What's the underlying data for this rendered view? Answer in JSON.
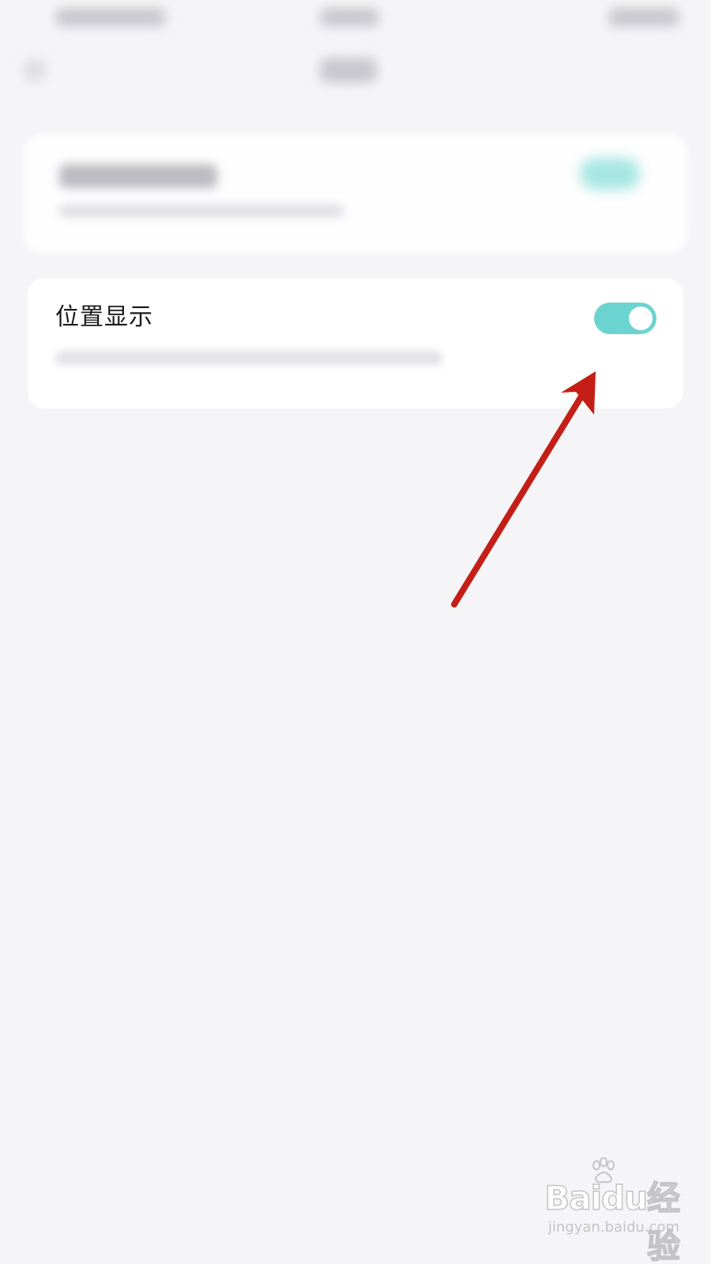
{
  "setting": {
    "label": "位置显示",
    "toggle_state": "on"
  },
  "colors": {
    "background": "#f5f5f8",
    "card": "#ffffff",
    "toggle_on": "#6bd4d1",
    "annotation_arrow": "#c41f16"
  },
  "icons": {
    "toggle": "toggle-switch-icon",
    "annotation": "red-arrow-icon"
  },
  "watermark": {
    "logo": "Baidu经验",
    "url": "jingyan.baidu.com"
  }
}
